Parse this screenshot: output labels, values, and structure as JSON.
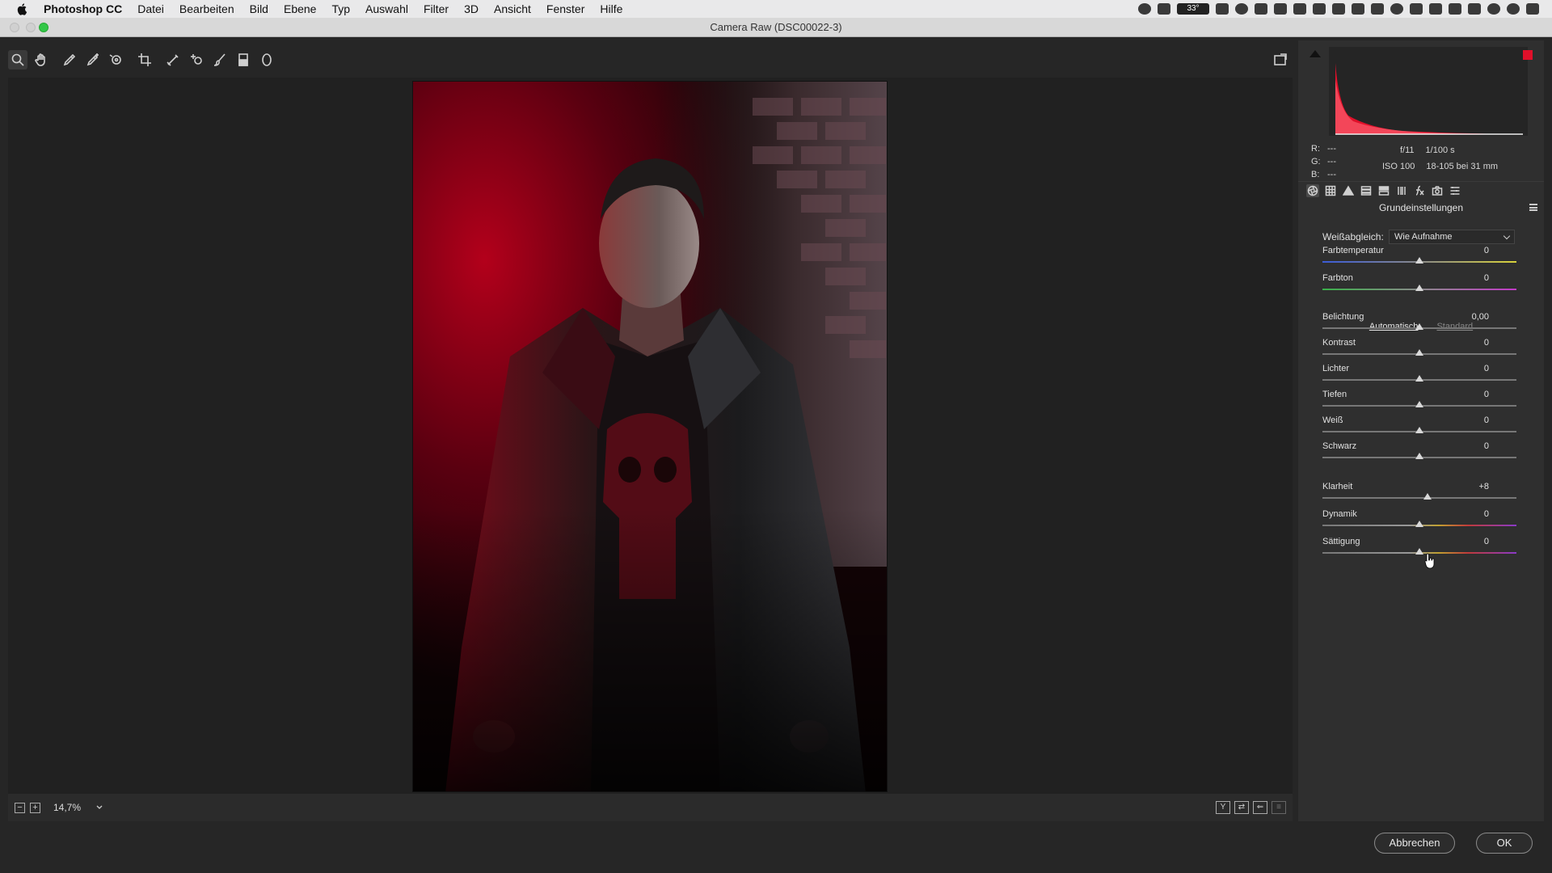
{
  "menubar": {
    "app_name": "Photoshop CC",
    "items": [
      "Datei",
      "Bearbeiten",
      "Bild",
      "Ebene",
      "Typ",
      "Auswahl",
      "Filter",
      "3D",
      "Ansicht",
      "Fenster",
      "Hilfe"
    ],
    "status_badge": "33°"
  },
  "window": {
    "title": "Camera Raw (DSC00022-3)"
  },
  "preview": {
    "zoom": "14,7%"
  },
  "histogram": {
    "r_label": "R:",
    "r_value": "---",
    "g_label": "G:",
    "g_value": "---",
    "b_label": "B:",
    "b_value": "---",
    "aperture": "f/11",
    "shutter": "1/100 s",
    "iso": "ISO 100",
    "lens": "18-105 bei 31 mm"
  },
  "panel": {
    "title": "Grundeinstellungen",
    "wb_label": "Weißabgleich:",
    "wb_value": "Wie Aufnahme",
    "auto_label": "Automatisch",
    "standard_label": "Standard",
    "sliders": [
      {
        "label": "Farbtemperatur",
        "value": "0",
        "position": 0.5,
        "gradient": "temp"
      },
      {
        "label": "Farbton",
        "value": "0",
        "position": 0.5,
        "gradient": "tint"
      },
      {
        "label": "Belichtung",
        "value": "0,00",
        "position": 0.5,
        "gradient": "none"
      },
      {
        "label": "Kontrast",
        "value": "0",
        "position": 0.5,
        "gradient": "none"
      },
      {
        "label": "Lichter",
        "value": "0",
        "position": 0.5,
        "gradient": "none"
      },
      {
        "label": "Tiefen",
        "value": "0",
        "position": 0.5,
        "gradient": "none"
      },
      {
        "label": "Weiß",
        "value": "0",
        "position": 0.5,
        "gradient": "none"
      },
      {
        "label": "Schwarz",
        "value": "0",
        "position": 0.5,
        "gradient": "none"
      },
      {
        "label": "Klarheit",
        "value": "+8",
        "position": 0.54,
        "gradient": "none"
      },
      {
        "label": "Dynamik",
        "value": "0",
        "position": 0.5,
        "gradient": "sat"
      },
      {
        "label": "Sättigung",
        "value": "0",
        "position": 0.5,
        "gradient": "sat"
      }
    ]
  },
  "buttons": {
    "cancel": "Abbrechen",
    "ok": "OK"
  },
  "colors": {
    "accent_red": "#e0102a",
    "panel_bg": "#2f2f2f",
    "preview_bg": "#212121"
  }
}
